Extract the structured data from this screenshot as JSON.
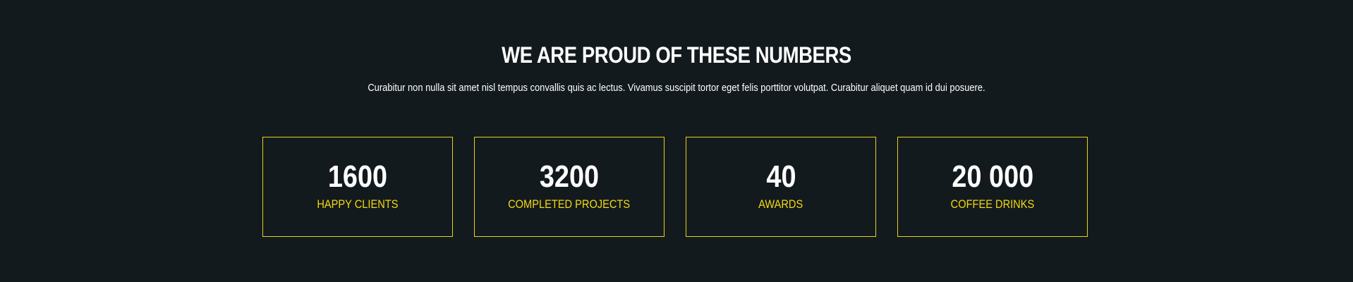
{
  "section": {
    "title": "WE ARE PROUD OF THESE NUMBERS",
    "subtitle": "Curabitur non nulla sit amet nisl tempus convallis quis ac lectus. Vivamus suscipit tortor eget felis porttitor volutpat. Curabitur aliquet quam id dui posuere."
  },
  "stats": [
    {
      "value": "1600",
      "label": "HAPPY CLIENTS"
    },
    {
      "value": "3200",
      "label": "COMPLETED PROJECTS"
    },
    {
      "value": "40",
      "label": "AWARDS"
    },
    {
      "value": "20 000",
      "label": "COFFEE DRINKS"
    }
  ],
  "colors": {
    "background": "#131a1d",
    "accent": "#f5d90f",
    "text": "#ffffff"
  }
}
